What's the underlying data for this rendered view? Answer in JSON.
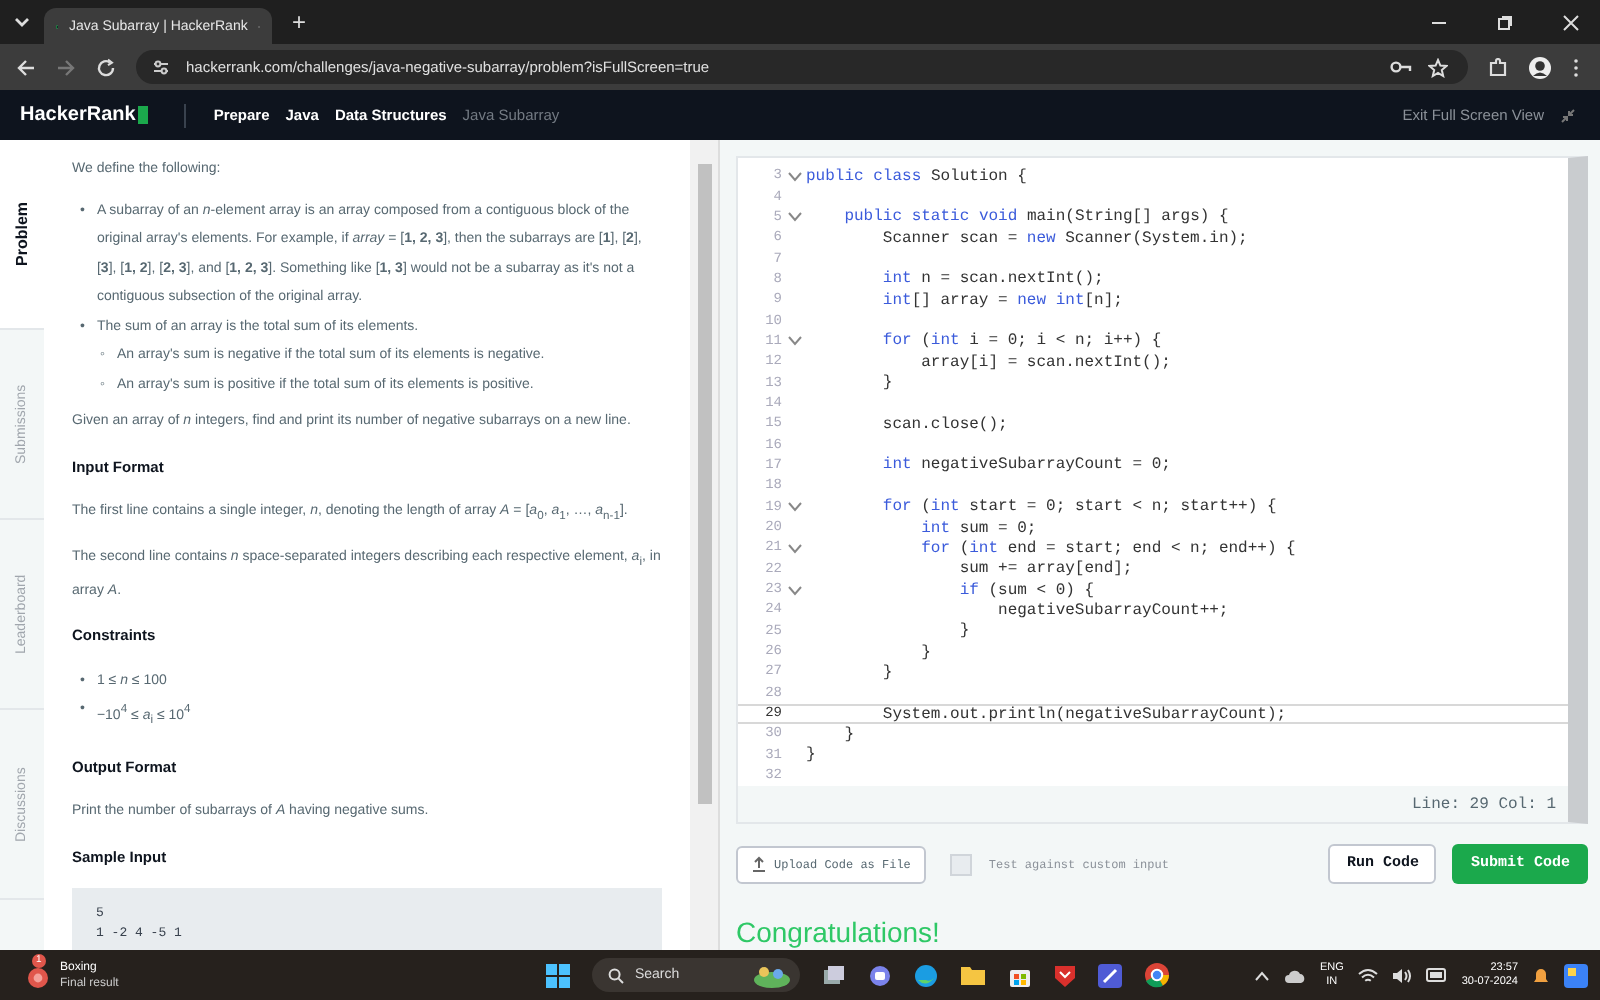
{
  "browser": {
    "tab_title": "Java Subarray | HackerRank",
    "new_tab": "+",
    "url": "hackerrank.com/challenges/java-negative-subarray/problem?isFullScreen=true"
  },
  "nav": {
    "logo": "HackerRank",
    "breadcrumbs": [
      {
        "label": "Prepare",
        "current": false
      },
      {
        "label": "Java",
        "current": false
      },
      {
        "label": "Data Structures",
        "current": false
      },
      {
        "label": "Java Subarray",
        "current": true
      }
    ],
    "exit": "Exit Full Screen View"
  },
  "side_tabs": [
    {
      "label": "Problem",
      "selected": true
    },
    {
      "label": "Submissions",
      "selected": false
    },
    {
      "label": "Leaderboard",
      "selected": false
    },
    {
      "label": "Discussions",
      "selected": false
    }
  ],
  "problem": [
    {
      "kind": "para",
      "text": "We define the following:"
    },
    {
      "kind": "list",
      "items": [
        {
          "marker": "•",
          "text": "A subarray of an *n*-element array is an array composed from a contiguous block of the original array's elements. For example, if *array* = [**1, 2, 3**], then the subarrays are [**1**], [**2**], [**3**], [**1, 2**], [**2, 3**], and [**1, 2, 3**]. Something like [**1, 3**] would not be a subarray as it's not a contiguous subsection of the original array."
        },
        {
          "marker": "•",
          "text": "The sum of an array is the total sum of its elements.",
          "children": [
            {
              "marker": "◦",
              "text": "An array's sum is negative if the total sum of its elements is negative."
            },
            {
              "marker": "◦",
              "text": "An array's sum is positive if the total sum of its elements is positive."
            }
          ]
        }
      ]
    },
    {
      "kind": "para",
      "text": "Given an array of *n* integers, find and print its number of negative subarrays on a new line."
    },
    {
      "kind": "heading",
      "text": "Input Format"
    },
    {
      "kind": "para",
      "text": "The first line contains a single integer, *n*, denoting the length of array *A* = [*a*$_{0}$, *a*$_{1}$, …, *a*$_{n-1}$]."
    },
    {
      "kind": "para",
      "text": "The second line contains *n* space-separated integers describing each respective element, *a*$_{i}$, in array *A*."
    },
    {
      "kind": "heading",
      "text": "Constraints"
    },
    {
      "kind": "list",
      "items": [
        {
          "marker": "•",
          "text": "1 ≤ *n* ≤ 100"
        },
        {
          "marker": "•",
          "text": "−10$^{4}$ ≤ *a*$_{i}$ ≤ 10$^{4}$"
        }
      ]
    },
    {
      "kind": "heading",
      "text": "Output Format"
    },
    {
      "kind": "para",
      "text": "Print the number of subarrays of *A* having negative sums."
    },
    {
      "kind": "heading",
      "text": "Sample Input"
    },
    {
      "kind": "code",
      "lines": [
        "5",
        "1 -2 4 -5 1"
      ]
    }
  ],
  "editor": {
    "lines": [
      {
        "number": "3",
        "text": "public class Solution {",
        "foldable": true,
        "current": false
      },
      {
        "number": "4",
        "foldable": false,
        "current": false
      },
      {
        "number": "5",
        "text": "    public static void main(String[] args) {",
        "foldable": true,
        "current": false
      },
      {
        "number": "6",
        "text": "        Scanner scan = new Scanner(System.in);",
        "foldable": false,
        "current": false
      },
      {
        "number": "7",
        "foldable": false,
        "current": false
      },
      {
        "number": "8",
        "text": "        int n = scan.nextInt();",
        "foldable": false,
        "current": false
      },
      {
        "number": "9",
        "text": "        int[] array = new int[n];",
        "foldable": false,
        "current": false
      },
      {
        "number": "10",
        "foldable": false,
        "current": false
      },
      {
        "number": "11",
        "text": "        for (int i = 0; i < n; i++) {",
        "foldable": true,
        "current": false
      },
      {
        "number": "12",
        "text": "            array[i] = scan.nextInt();",
        "foldable": false,
        "current": false
      },
      {
        "number": "13",
        "text": "        }",
        "foldable": false,
        "current": false
      },
      {
        "number": "14",
        "foldable": false,
        "current": false
      },
      {
        "number": "15",
        "text": "        scan.close();",
        "foldable": false,
        "current": false
      },
      {
        "number": "16",
        "foldable": false,
        "current": false
      },
      {
        "number": "17",
        "text": "        int negativeSubarrayCount = 0;",
        "foldable": false,
        "current": false
      },
      {
        "number": "18",
        "foldable": false,
        "current": false
      },
      {
        "number": "19",
        "text": "        for (int start = 0; start < n; start++) {",
        "foldable": true,
        "current": false
      },
      {
        "number": "20",
        "text": "            int sum = 0;",
        "foldable": false,
        "current": false
      },
      {
        "number": "21",
        "text": "            for (int end = start; end < n; end++) {",
        "foldable": true,
        "current": false
      },
      {
        "number": "22",
        "text": "                sum += array[end];",
        "foldable": false,
        "current": false
      },
      {
        "number": "23",
        "text": "                if (sum < 0) {",
        "foldable": true,
        "current": false
      },
      {
        "number": "24",
        "text": "                    negativeSubarrayCount++;",
        "foldable": false,
        "current": false
      },
      {
        "number": "25",
        "text": "                }",
        "foldable": false,
        "current": false
      },
      {
        "number": "26",
        "text": "            }",
        "foldable": false,
        "current": false
      },
      {
        "number": "27",
        "text": "        }",
        "foldable": false,
        "current": false
      },
      {
        "number": "28",
        "foldable": false,
        "current": false
      },
      {
        "number": "29",
        "text": "        System.out.println(negativeSubarrayCount);",
        "foldable": false,
        "current": true
      },
      {
        "number": "30",
        "text": "    }",
        "foldable": false,
        "current": false
      },
      {
        "number": "31",
        "text": "}",
        "foldable": false,
        "current": false
      },
      {
        "number": "32",
        "foldable": false,
        "current": false
      }
    ],
    "status": "Line: 29 Col: 1"
  },
  "actions": {
    "upload": "Upload Code as File",
    "custom_input": {
      "label": "Test against custom input",
      "checked": false
    },
    "run": "Run Code",
    "submit": "Submit Code"
  },
  "result": {
    "title": "Congratulations!"
  },
  "taskbar": {
    "weather_title": "Boxing",
    "weather_subtitle": "Final result",
    "weather_badge": "1",
    "search": "Search",
    "language": "ENG",
    "region": "IN",
    "time": "23:57",
    "date": "30-07-2024"
  }
}
